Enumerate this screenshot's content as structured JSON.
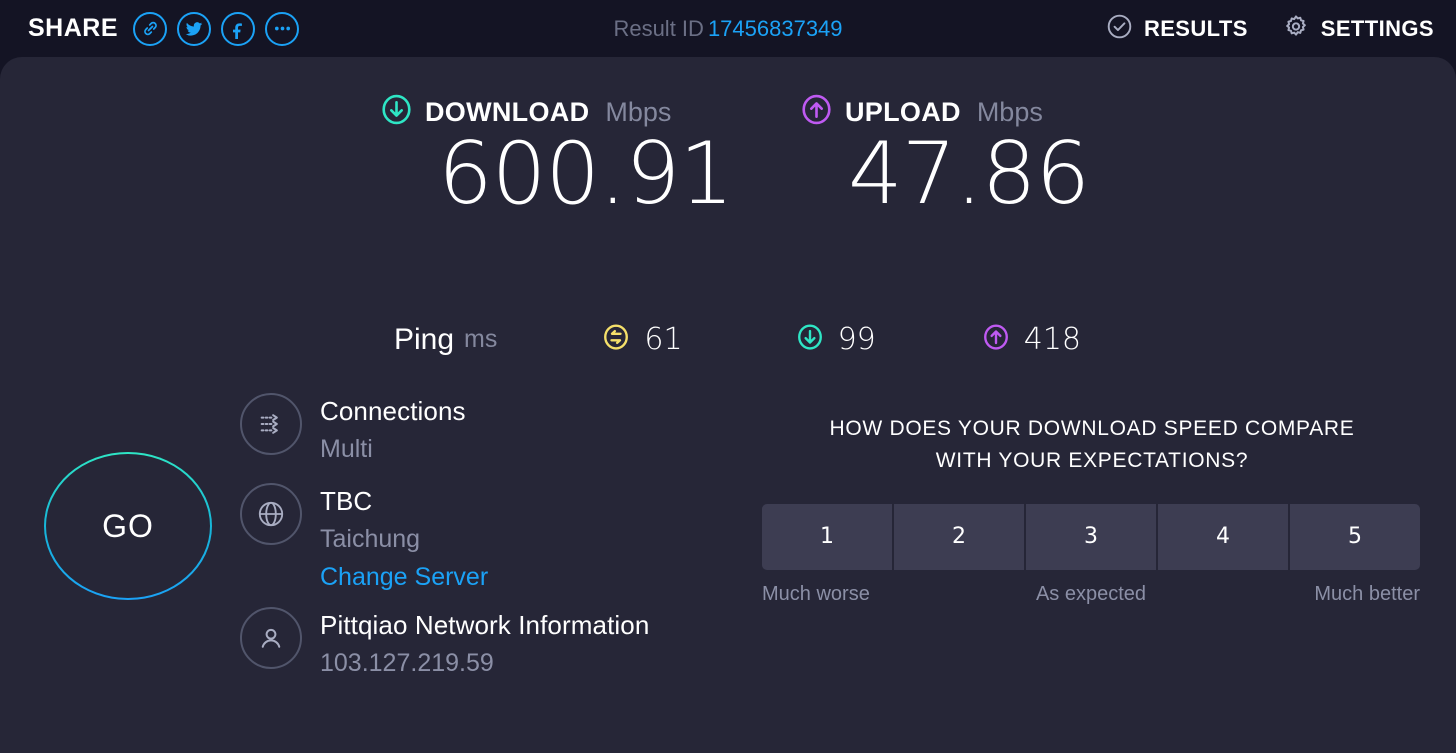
{
  "header": {
    "share_label": "SHARE",
    "share_icons": [
      {
        "name": "link-icon"
      },
      {
        "name": "twitter-icon"
      },
      {
        "name": "facebook-icon"
      },
      {
        "name": "more-options-icon"
      }
    ],
    "result_id_label": "Result ID",
    "result_id_value": "17456837349",
    "results_label": "RESULTS",
    "settings_label": "SETTINGS"
  },
  "speeds": {
    "download": {
      "title": "DOWNLOAD",
      "unit": "Mbps",
      "value": "600.91",
      "color": "#2ee6c5"
    },
    "upload": {
      "title": "UPLOAD",
      "unit": "Mbps",
      "value": "47.86",
      "color": "#bf5af2"
    }
  },
  "ping": {
    "label": "Ping",
    "unit": "ms",
    "idle": {
      "value": "61",
      "color": "#f5e06a"
    },
    "download": {
      "value": "99",
      "color": "#2ee6c5"
    },
    "upload": {
      "value": "418",
      "color": "#bf5af2"
    }
  },
  "go_button": {
    "label": "GO"
  },
  "info": {
    "connections": {
      "primary": "Connections",
      "secondary": "Multi"
    },
    "server": {
      "primary": "TBC",
      "secondary": "Taichung",
      "change_link": "Change Server"
    },
    "provider": {
      "primary": "Pittqiao Network Information",
      "secondary": "103.127.219.59"
    }
  },
  "survey": {
    "question_line1": "HOW DOES YOUR DOWNLOAD SPEED COMPARE",
    "question_line2": "WITH YOUR EXPECTATIONS?",
    "options": [
      "1",
      "2",
      "3",
      "4",
      "5"
    ],
    "legend_left": "Much worse",
    "legend_mid": "As expected",
    "legend_right": "Much better"
  }
}
